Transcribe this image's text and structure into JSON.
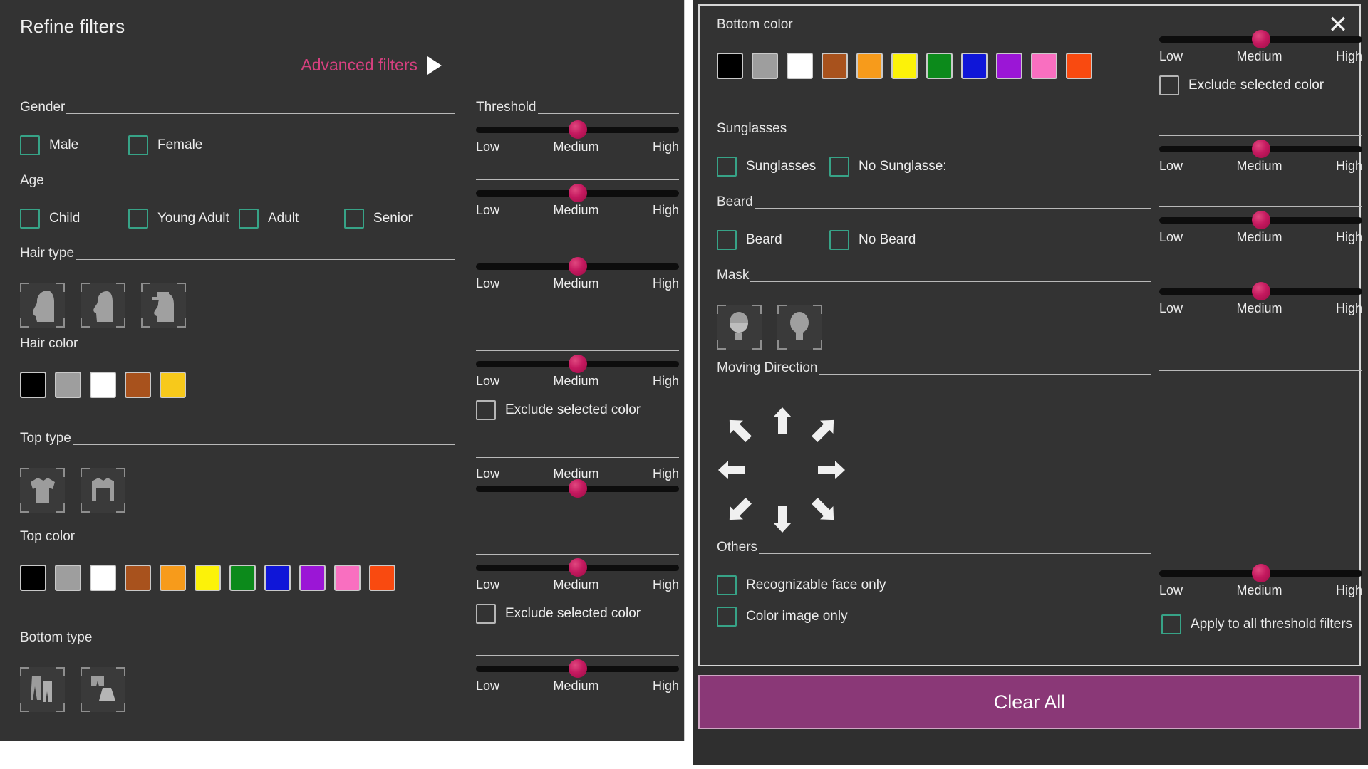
{
  "window": {
    "title": "Refine filters",
    "close_icon": "close-icon",
    "advanced_filters_label": "Advanced filters",
    "advanced_filters_arrow_icon": "play-triangle-icon",
    "accent_pink": "#d6407f",
    "checkbox_teal": "#37a387",
    "panel_bg": "#333333",
    "slider_thumb": "#c4195f",
    "clear_all_bg": "#8a3877"
  },
  "slider_ticks": {
    "low": "Low",
    "medium": "Medium",
    "high": "High"
  },
  "left": {
    "sections": {
      "gender": {
        "label": "Gender",
        "options": [
          "Male",
          "Female"
        ]
      },
      "age": {
        "label": "Age",
        "options": [
          "Child",
          "Young Adult",
          "Adult",
          "Senior"
        ]
      },
      "hair_type": {
        "label": "Hair type",
        "icons": [
          "long-hair-icon",
          "short-hair-icon",
          "hat-icon"
        ]
      },
      "hair_color": {
        "label": "Hair color",
        "colors": [
          "#000000",
          "#9e9e9e",
          "#ffffff",
          "#a8521d",
          "#f7c91b"
        ]
      },
      "top_type": {
        "label": "Top type",
        "icons": [
          "short-sleeve-shirt-icon",
          "long-sleeve-shirt-icon"
        ]
      },
      "top_color": {
        "label": "Top color",
        "colors": [
          "#000000",
          "#9e9e9e",
          "#ffffff",
          "#a8521d",
          "#f79b1b",
          "#fcf209",
          "#0c8a1b",
          "#0f16d8",
          "#9b16d6",
          "#f96fc0",
          "#f94a10"
        ]
      },
      "bottom_type": {
        "label": "Bottom type",
        "icons": [
          "trousers-icon",
          "shorts-skirt-icon"
        ]
      }
    },
    "threshold_label": "Threshold",
    "exclude_label": "Exclude selected color",
    "sliders": [
      {
        "name": "threshold-slider",
        "value": "Medium",
        "percent": 50,
        "labels_on_top": false,
        "has_heading": true,
        "has_exclude": false
      },
      {
        "name": "age-threshold-slider",
        "value": "Medium",
        "percent": 50,
        "labels_on_top": false,
        "has_heading": false,
        "has_exclude": false
      },
      {
        "name": "hairtype-threshold-slider",
        "value": "Medium",
        "percent": 50,
        "labels_on_top": false,
        "has_heading": false,
        "has_exclude": false
      },
      {
        "name": "haircolor-threshold-slider",
        "value": "Medium",
        "percent": 50,
        "labels_on_top": false,
        "has_heading": false,
        "has_exclude": true
      },
      {
        "name": "toptype-threshold-slider",
        "value": "Medium",
        "percent": 50,
        "labels_on_top": true,
        "has_heading": false,
        "has_exclude": false
      },
      {
        "name": "topcolor-threshold-slider",
        "value": "Medium",
        "percent": 50,
        "labels_on_top": false,
        "has_heading": false,
        "has_exclude": true
      },
      {
        "name": "bottomtype-threshold-slider",
        "value": "Medium",
        "percent": 50,
        "labels_on_top": false,
        "has_heading": false,
        "has_exclude": false
      }
    ]
  },
  "right": {
    "sections": {
      "bottom_color": {
        "label": "Bottom color",
        "colors": [
          "#000000",
          "#9e9e9e",
          "#ffffff",
          "#a8521d",
          "#f79b1b",
          "#fcf209",
          "#0c8a1b",
          "#0f16d8",
          "#9b16d6",
          "#f96fc0",
          "#f94a10"
        ]
      },
      "sunglasses": {
        "label": "Sunglasses",
        "options": [
          "Sunglasses",
          "No Sunglasse:"
        ]
      },
      "beard": {
        "label": "Beard",
        "options": [
          "Beard",
          "No Beard"
        ]
      },
      "mask": {
        "label": "Mask",
        "icons": [
          "masked-face-icon",
          "unmasked-face-icon"
        ]
      },
      "moving_direction": {
        "label": "Moving Direction",
        "arrows": [
          "arrow-up-left-icon",
          "arrow-up-icon",
          "arrow-up-right-icon",
          "arrow-left-icon",
          "arrow-right-icon",
          "arrow-down-left-icon",
          "arrow-down-icon",
          "arrow-down-right-icon"
        ]
      },
      "others": {
        "label": "Others",
        "options": [
          "Recognizable face only",
          "Color image only"
        ]
      }
    },
    "exclude_label": "Exclude selected color",
    "apply_all_label": "Apply to all threshold filters",
    "sliders": [
      {
        "name": "bottomcolor-threshold-slider",
        "value": "Medium",
        "percent": 50,
        "has_exclude": true
      },
      {
        "name": "sunglasses-threshold-slider",
        "value": "Medium",
        "percent": 50,
        "has_exclude": false
      },
      {
        "name": "beard-threshold-slider",
        "value": "Medium",
        "percent": 50,
        "has_exclude": false
      },
      {
        "name": "mask-threshold-slider",
        "value": "Medium",
        "percent": 50,
        "has_exclude": false
      },
      {
        "name": "others-threshold-slider",
        "value": "Medium",
        "percent": 50,
        "has_exclude": false
      }
    ],
    "clear_all_label": "Clear All"
  }
}
